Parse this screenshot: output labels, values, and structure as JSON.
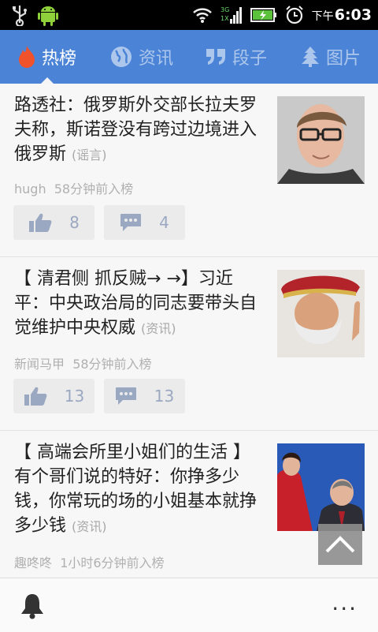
{
  "statusbar": {
    "ampm": "下午",
    "time": "6:03"
  },
  "tabs": [
    {
      "label": "热榜",
      "icon": "flame-icon"
    },
    {
      "label": "资讯",
      "icon": "globe-icon"
    },
    {
      "label": "段子",
      "icon": "quote-icon"
    },
    {
      "label": "图片",
      "icon": "tree-icon"
    }
  ],
  "items": [
    {
      "title": "路透社：俄罗斯外交部长拉夫罗夫称，斯诺登没有跨过边境进入俄罗斯",
      "tag": "(谣言)",
      "source": "hugh",
      "time": "58分钟前入榜",
      "likes": "8",
      "comments": "4"
    },
    {
      "title": "【 清君侧 抓反贼→ →】习近平：中央政治局的同志要带头自觉维护中央权威",
      "tag": "(资讯)",
      "source": "新闻马甲",
      "time": "58分钟前入榜",
      "likes": "13",
      "comments": "13"
    },
    {
      "title": "【 高端会所里小姐们的生活 】有个哥们说的特好：你挣多少钱，你常玩的场的小姐基本就挣多少钱",
      "tag": "(资讯)",
      "source": "趣咚咚",
      "time": "1小时6分钟前入榜"
    }
  ],
  "bottombar": {
    "more_label": "···"
  },
  "colors": {
    "tabbar": "#4b84d6",
    "active_flame": "#f0532c",
    "meta": "#b0b0b0"
  }
}
